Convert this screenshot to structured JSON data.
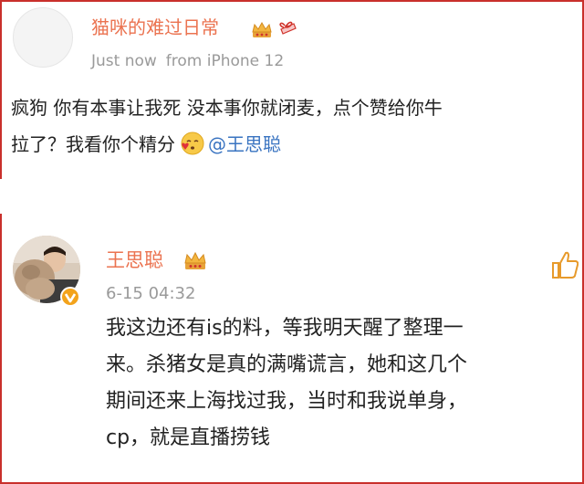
{
  "post1": {
    "username": "猫咪的难过日常",
    "time": "Just now",
    "source": "from iPhone 12",
    "body_line1": "疯狗 你有本事让我死 没本事你就闭麦，点个赞给你牛",
    "body_line2_text": "拉了？我看你个精分",
    "mention": "@王思聪",
    "badges": [
      "crown-icon",
      "gift-icon"
    ],
    "emoji": "kiss-heart-emoji"
  },
  "post2": {
    "username": "王思聪",
    "time": "6-15 04:32",
    "body_lines": [
      "我这边还有is的料，等我明天醒了整理一",
      "来。杀猪女是真的满嘴谎言，她和这几个",
      "期间还来上海找过我，当时和我说单身，",
      "cp，就是直播捞钱"
    ],
    "verified": "verified-v-icon",
    "action_icon": "thumbs-up-icon"
  },
  "colors": {
    "username": "#eb7350",
    "mention": "#3a74c1",
    "frame": "#c9302c",
    "meta": "#9a9a9a"
  }
}
